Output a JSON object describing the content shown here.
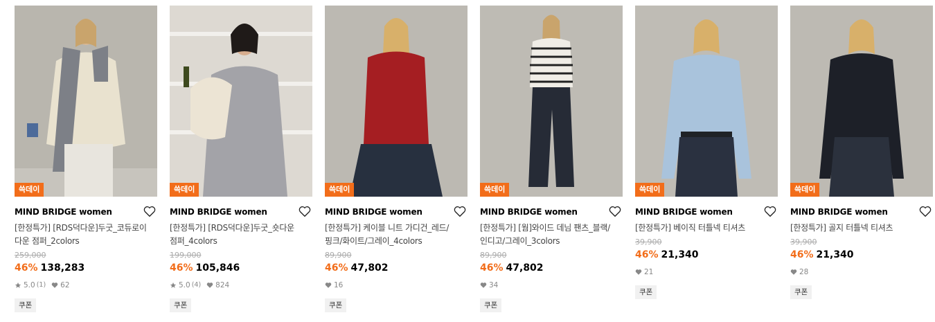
{
  "products": [
    {
      "tag": "쓱데이",
      "brand": "MIND BRIDGE women",
      "name_line1": "[한정특가] [RDS덕다운]두굿_코듀로이",
      "name_line2": "다운 점퍼_2colors",
      "original_price": "259,000",
      "discount": "46%",
      "price": "138,283",
      "rating": "5.0",
      "review_count": "(1)",
      "likes": "62",
      "coupon": "쿠폰"
    },
    {
      "tag": "쓱데이",
      "brand": "MIND BRIDGE women",
      "name_line1": "[한정특가] [RDS덕다운]두굿_숏다운",
      "name_line2": "점퍼_4colors",
      "original_price": "199,000",
      "discount": "46%",
      "price": "105,846",
      "rating": "5.0",
      "review_count": "(4)",
      "likes": "824",
      "coupon": "쿠폰"
    },
    {
      "tag": "쓱데이",
      "brand": "MIND BRIDGE women",
      "name_line1": "[한정특가] 케이블 니트 가디건_레드/",
      "name_line2": "핑크/화이트/그레이_4colors",
      "original_price": "89,900",
      "discount": "46%",
      "price": "47,802",
      "likes": "16",
      "coupon": "쿠폰"
    },
    {
      "tag": "쓱데이",
      "brand": "MIND BRIDGE women",
      "name_line1": "[한정특가] [웜]와이드 데님 팬츠_블랙/",
      "name_line2": "인디고/그레이_3colors",
      "original_price": "89,900",
      "discount": "46%",
      "price": "47,802",
      "likes": "34",
      "coupon": "쿠폰"
    },
    {
      "tag": "쓱데이",
      "brand": "MIND BRIDGE women",
      "name_line1": "[한정특가] 베이직 터틀넥 티셔츠",
      "name_line2": "",
      "original_price": "39,900",
      "discount": "46%",
      "price": "21,340",
      "likes": "21",
      "coupon": "쿠폰"
    },
    {
      "tag": "쓱데이",
      "brand": "MIND BRIDGE women",
      "name_line1": "[한정특가] 골지 터틀넥 티셔츠",
      "name_line2": "",
      "original_price": "39,900",
      "discount": "46%",
      "price": "21,340",
      "likes": "28",
      "coupon": "쿠폰"
    }
  ],
  "colors": {
    "accent": "#f26d1a",
    "muted": "#aaaaaa",
    "coupon_bg": "#f1f1f1"
  },
  "icons": {
    "wishlist": "heart-outline-icon",
    "rating": "star-icon",
    "likes": "heart-filled-icon"
  }
}
